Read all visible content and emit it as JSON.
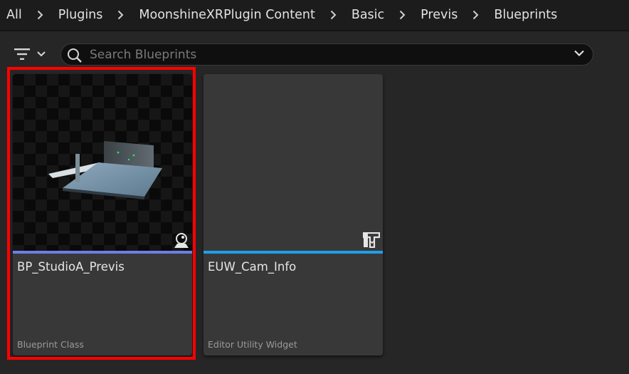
{
  "breadcrumb": {
    "items": [
      "All",
      "Plugins",
      "MoonshineXRPlugin Content",
      "Basic",
      "Previs",
      "Blueprints"
    ]
  },
  "toolbar": {
    "filter_icon": "filter-icon",
    "search": {
      "placeholder": "Search Blueprints",
      "value": ""
    }
  },
  "assets": [
    {
      "name": "BP_StudioA_Previs",
      "type": "Blueprint Class",
      "accent_color": "#6b7ee8",
      "thumbnail": "studio-scene-thumbnail",
      "type_icon": "blueprint-actor-icon",
      "selected": true
    },
    {
      "name": "EUW_Cam_Info",
      "type": "Editor Utility Widget",
      "accent_color": "#1fa0e6",
      "thumbnail": "blank-thumbnail",
      "type_icon": "widget-icon",
      "selected": false
    }
  ],
  "colors": {
    "background": "#262626",
    "breadcrumb_bar": "#1c1c1c",
    "tile": "#383838",
    "selection": "#ff0000"
  }
}
